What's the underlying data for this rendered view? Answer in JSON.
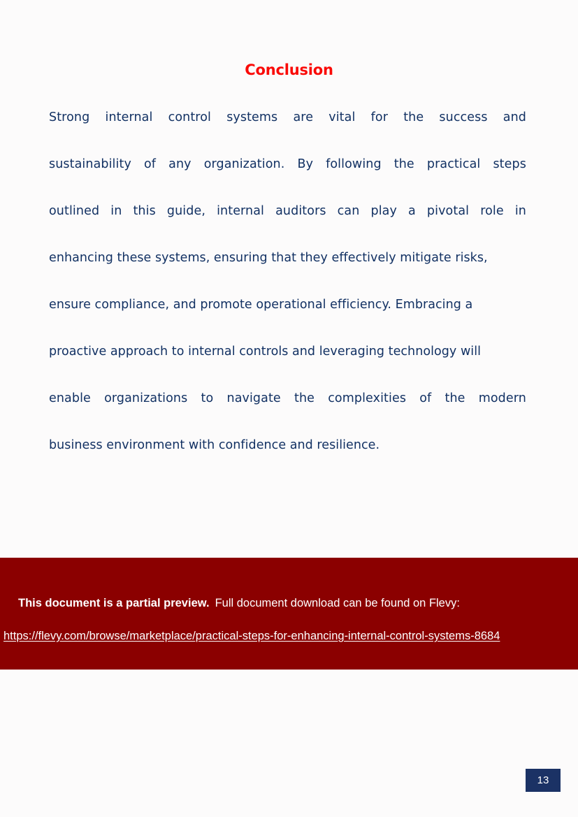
{
  "page": {
    "background_color": "#fcfbfb",
    "number": "13",
    "badge_color": "#1b3265"
  },
  "heading": {
    "text": "Conclusion",
    "color": "#fa0a07"
  },
  "body": {
    "text_color": "#123163",
    "paragraph": "Strong internal control systems are vital for the success and sustainability of any organization. By following the practical steps outlined in this guide, internal auditors can play a pivotal role in enhancing these systems, ensuring that they effectively mitigate risks, ensure compliance, and promote operational efficiency. Embracing a proactive approach to internal controls and leveraging technology will enable organizations to navigate the complexities of the modern business environment with confidence and resilience.",
    "lines": [
      {
        "justified": true,
        "words": [
          "Strong",
          "internal",
          "control",
          "systems",
          "are",
          "vital",
          "for",
          "the",
          "success",
          "and"
        ]
      },
      {
        "justified": true,
        "words": [
          "sustainability",
          "of",
          "any",
          "organization.",
          "By",
          "following",
          "the",
          "practical",
          "steps"
        ]
      },
      {
        "justified": true,
        "words": [
          "outlined",
          "in",
          "this",
          "guide,",
          "internal",
          "auditors",
          "can",
          "play",
          "a",
          "pivotal",
          "role",
          "in"
        ]
      },
      {
        "justified": false,
        "text": "enhancing these systems, ensuring that they effectively mitigate risks,"
      },
      {
        "justified": false,
        "text": "ensure compliance, and promote operational efficiency. Embracing a"
      },
      {
        "justified": false,
        "text": "proactive approach to internal controls and leveraging technology will"
      },
      {
        "justified": true,
        "words": [
          "enable",
          "organizations",
          "to",
          "navigate",
          "the",
          "complexities",
          "of",
          "the",
          "modern"
        ]
      },
      {
        "justified": false,
        "text": "business environment with confidence and resilience."
      }
    ]
  },
  "banner": {
    "background_color": "#8b0000",
    "text_color": "#ffffff",
    "notice_bold": "This document is a partial preview.",
    "notice_rest": "Full document download can be found on Flevy:",
    "url": "https://flevy.com/browse/marketplace/practical-steps-for-enhancing-internal-control-systems-8684"
  }
}
